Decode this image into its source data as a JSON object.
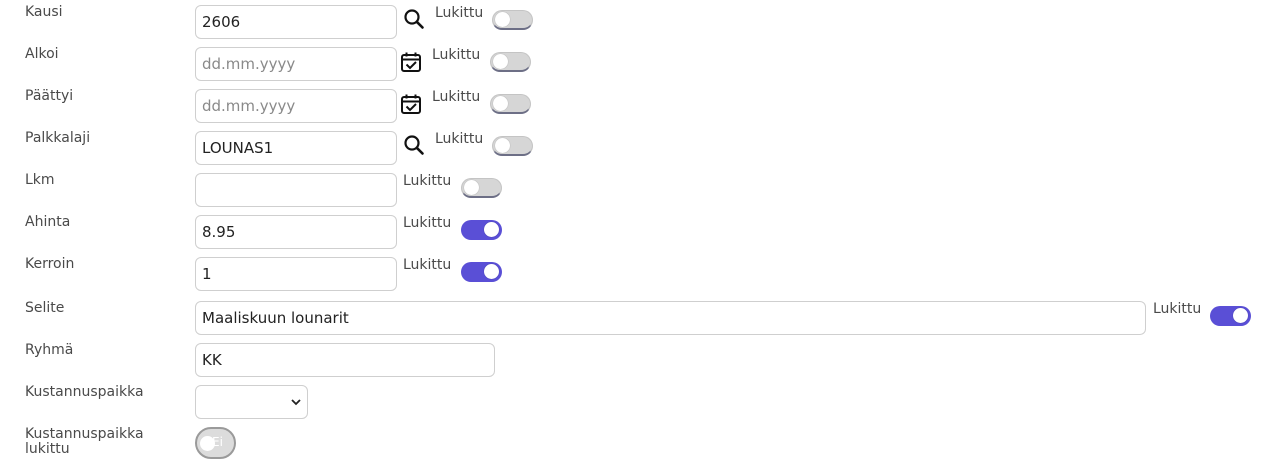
{
  "form": {
    "locked_label": "Lukittu",
    "rows": {
      "kausi": {
        "label": "Kausi",
        "value": "2606",
        "locked": false,
        "icon": "search-icon"
      },
      "alkoi": {
        "label": "Alkoi",
        "value": "",
        "placeholder": "dd.mm.yyyy",
        "locked": false,
        "icon": "calendar-icon"
      },
      "paattyi": {
        "label": "Päättyi",
        "value": "",
        "placeholder": "dd.mm.yyyy",
        "locked": false,
        "icon": "calendar-icon"
      },
      "palkkalaji": {
        "label": "Palkkalaji",
        "value": "LOUNAS1",
        "locked": false,
        "icon": "search-icon"
      },
      "lkm": {
        "label": "Lkm",
        "value": "",
        "locked": false
      },
      "ahinta": {
        "label": "Ahinta",
        "value": "8.95",
        "locked": true
      },
      "kerroin": {
        "label": "Kerroin",
        "value": "1",
        "locked": true
      },
      "selite": {
        "label": "Selite",
        "value": "Maaliskuun lounarit",
        "locked": true
      },
      "ryhma": {
        "label": "Ryhmä",
        "value": "KK"
      },
      "kustannuspaikka": {
        "label": "Kustannuspaikka",
        "value": ""
      },
      "kustannuspaikka_lukittu": {
        "label_line1": "Kustannuspaikka",
        "label_line2": "lukittu",
        "toggle_text": "Ei",
        "value": false
      }
    }
  },
  "colors": {
    "accent": "#5a4fd6",
    "toggle_off": "#d6d6d6",
    "label_text": "#4a4a4a"
  }
}
